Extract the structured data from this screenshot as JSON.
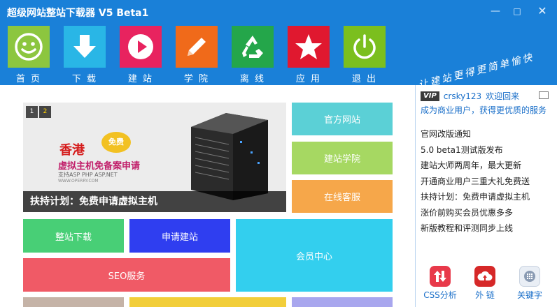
{
  "window": {
    "title": "超级网站整站下载器 V5 Beta1",
    "minimize": "—",
    "maximize": "□",
    "close": "✕"
  },
  "toolbar": {
    "items": [
      {
        "label": "首 页",
        "icon": "smiley-icon",
        "color": "#8cc63f"
      },
      {
        "label": "下 载",
        "icon": "download-arrow-icon",
        "color": "#29b6e6"
      },
      {
        "label": "建 站",
        "icon": "play-icon",
        "color": "#e8235f"
      },
      {
        "label": "学 院",
        "icon": "pencil-icon",
        "color": "#f06a1a"
      },
      {
        "label": "离 线",
        "icon": "recycle-icon",
        "color": "#24a64a"
      },
      {
        "label": "应 用",
        "icon": "star-icon",
        "color": "#e0182f"
      },
      {
        "label": "退 出",
        "icon": "power-icon",
        "color": "#7bbf1e"
      }
    ],
    "slogan": "让建站更得更简单愉快"
  },
  "banner": {
    "pages": [
      "1",
      "2"
    ],
    "active_page": "2",
    "caption": "扶持计划：免费申请虚拟主机",
    "ad_title": "香港",
    "ad_badge": "免费",
    "ad_subtitle": "虚拟主机免备案申请",
    "ad_tech": "支持ASP PHP ASP.NET",
    "ad_url": "WWW.OPERRY.COM"
  },
  "tiles": {
    "official_site": "官方网站",
    "academy": "建站学院",
    "online_service": "在线客服",
    "site_download": "整站下载",
    "apply_site": "申请建站",
    "member_center": "会员中心",
    "seo_service": "SEO服务"
  },
  "colors": {
    "titlebar": "#1a80d8",
    "tile_cyan": "#5bd0d6",
    "tile_green": "#a6d862",
    "tile_orange": "#f6a74a",
    "tile_mint": "#48cf76",
    "tile_blue": "#2f3ef0",
    "tile_sky": "#33cfee",
    "tile_red": "#f05a66",
    "link": "#1a6fc9"
  },
  "user": {
    "vip_badge": "VIP",
    "username": "crsky123",
    "welcome": "欢迎回来",
    "upgrade_text": "成为商业用户，获得更优质的服务"
  },
  "news": [
    "官网改版通知",
    "5.0 beta1测试版发布",
    "建站大师两周年，最大更新",
    "开通商业用户三重大礼免费送",
    "扶持计划：免费申请虚拟主机",
    "涨价前购买会员优惠多多",
    "新版教程和评测同步上线"
  ],
  "right_tools": [
    {
      "label": "CSS分析",
      "icon": "arrows-up-down-icon",
      "color": "#e8394a"
    },
    {
      "label": "外 链",
      "icon": "cloud-upload-icon",
      "color": "#d62828"
    },
    {
      "label": "关键字",
      "icon": "keypad-icon",
      "color": "#e9eef5"
    }
  ]
}
